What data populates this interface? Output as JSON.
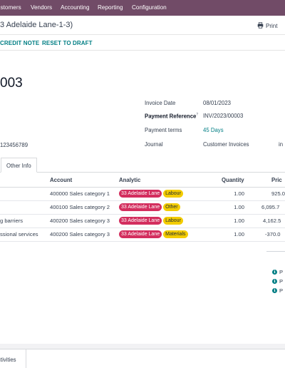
{
  "topnav": {
    "items": [
      "ustomers",
      "Vendors",
      "Accounting",
      "Reporting",
      "Configuration"
    ]
  },
  "breadcrumb": {
    "text": "3 Adelaide Lane-1-3)",
    "print_label": "Print"
  },
  "actions": {
    "credit_note": "CREDIT NOTE",
    "reset_to_draft": "RESET TO DRAFT"
  },
  "invoice": {
    "number": "003",
    "vat": "123456789",
    "fields": {
      "invoice_date_label": "Invoice Date",
      "invoice_date": "08/01/2023",
      "payment_reference_label": "Payment Reference",
      "payment_reference_help": "?",
      "payment_reference": "INV/2023/00003",
      "payment_terms_label": "Payment terms",
      "payment_terms": "45 Days",
      "journal_label": "Journal",
      "journal": "Customer Invoices",
      "journal_currency_prefix": "in"
    }
  },
  "tabs": {
    "other_info": "Other Info"
  },
  "table": {
    "headers": {
      "account": "Account",
      "analytic": "Analytic",
      "quantity": "Quantity",
      "price": "Pric"
    },
    "rows": [
      {
        "label": "",
        "account": "400000 Sales category 1",
        "analytic_location": "33 Adelaide Lane",
        "analytic_category": "Labour",
        "quantity": "1.00",
        "price": "925.0"
      },
      {
        "label": "",
        "account": "400100 Sales category 2",
        "analytic_location": "33 Adelaide Lane",
        "analytic_category": "Other",
        "quantity": "1.00",
        "price": "6,095.7"
      },
      {
        "label": "g barriers",
        "account": "400200 Sales category 3",
        "analytic_location": "33 Adelaide Lane",
        "analytic_category": "Labour",
        "quantity": "1.00",
        "price": "4,162.5"
      },
      {
        "label": "ssional services",
        "account": "400200 Sales category 3",
        "analytic_location": "33 Adelaide Lane",
        "analytic_category": "Materials",
        "quantity": "1.00",
        "price": "-370.0"
      }
    ]
  },
  "payments": {
    "items": [
      "P",
      "P",
      "P"
    ],
    "icon": "info-circle-icon"
  },
  "chatter": {
    "activities_label": "ctivities"
  },
  "colors": {
    "brand": "#714b67",
    "link": "#017e84",
    "tag_location": "#d32e5e",
    "tag_category": "#f3cc00"
  }
}
